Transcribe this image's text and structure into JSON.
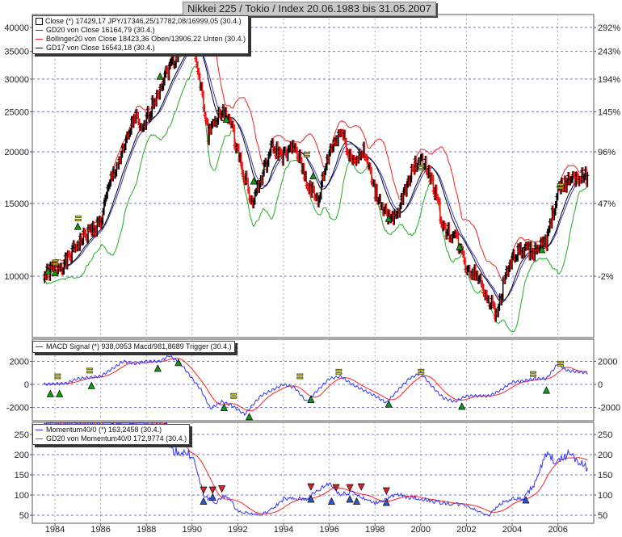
{
  "title": "Nikkei 225 / Tokio / Index 20.06.1983 bis 31.05.2007",
  "legend_main": [
    "Close (*) 17429,17 JPY/17346,25/17782,08/16999,05 (30.4.)",
    "GD20 von Close 16164,79 (30.4.)",
    "Bollinger20 von Close 18423,36 Oben/13906,22 Unten (30.4.)",
    "GD17 von Close 16543,18 (30.4.)"
  ],
  "legend_macd": [
    "MACD Signal (*) 938,0953 Macd/981,8689 Trigger (30.4.)"
  ],
  "legend_mom": [
    "Momentum40/0 (*) 163,2458 (30.4.)",
    "GD20 von Momentum40/0 172,9774 (30.4.)"
  ],
  "colors": {
    "close": "#000000",
    "gd20": "#3333cc",
    "bollinger": "#ee2222",
    "bollinger_lower": "#22aa22",
    "gd17": "#000000",
    "macd": "#3333ff",
    "trigger": "#ff2222",
    "grid": "#7777bb"
  },
  "chart_data": [
    {
      "type": "line",
      "panel": "price",
      "scale": "log",
      "ylim": [
        8000,
        40000
      ],
      "yticks_left": [
        "40000",
        "35000",
        "30000",
        "25000",
        "20000",
        "15000",
        "10000"
      ],
      "ytick_values": [
        40000,
        35000,
        30000,
        25000,
        20000,
        15000,
        10000
      ],
      "yticks_right": [
        "292%",
        "243%",
        "194%",
        "145%",
        "96%",
        "47%",
        "-2%"
      ],
      "xticks": [
        "1984",
        "1986",
        "1988",
        "1990",
        "1992",
        "1994",
        "1996",
        "1998",
        "2000",
        "2002",
        "2004",
        "2006"
      ],
      "close": [
        [
          1983.5,
          10000
        ],
        [
          1984,
          10500
        ],
        [
          1984.5,
          10800
        ],
        [
          1985,
          12000
        ],
        [
          1985.5,
          12800
        ],
        [
          1986,
          13500
        ],
        [
          1986.5,
          17500
        ],
        [
          1987,
          20000
        ],
        [
          1987.5,
          24500
        ],
        [
          1987.8,
          22000
        ],
        [
          1988,
          24000
        ],
        [
          1988.5,
          28000
        ],
        [
          1989,
          32000
        ],
        [
          1989.9,
          38900
        ],
        [
          1990.3,
          30000
        ],
        [
          1990.7,
          22000
        ],
        [
          1991,
          24000
        ],
        [
          1991.5,
          25000
        ],
        [
          1992,
          20000
        ],
        [
          1992.6,
          15000
        ],
        [
          1993,
          17000
        ],
        [
          1993.5,
          20500
        ],
        [
          1994,
          19500
        ],
        [
          1994.5,
          20500
        ],
        [
          1995,
          17000
        ],
        [
          1995.5,
          15000
        ],
        [
          1996,
          20000
        ],
        [
          1996.5,
          22500
        ],
        [
          1997,
          19000
        ],
        [
          1997.5,
          20000
        ],
        [
          1998,
          16000
        ],
        [
          1998.7,
          13500
        ],
        [
          1999,
          14000
        ],
        [
          1999.5,
          17500
        ],
        [
          2000,
          19500
        ],
        [
          2000.5,
          17000
        ],
        [
          2001,
          13000
        ],
        [
          2001.5,
          12500
        ],
        [
          2002,
          10500
        ],
        [
          2002.5,
          10000
        ],
        [
          2003.3,
          8000
        ],
        [
          2003.8,
          10500
        ],
        [
          2004.3,
          11500
        ],
        [
          2005,
          11500
        ],
        [
          2005.5,
          12000
        ],
        [
          2006,
          16000
        ],
        [
          2006.4,
          17000
        ],
        [
          2006.8,
          17500
        ],
        [
          2007.3,
          17400
        ]
      ],
      "signals_buy": [
        [
          1983.7,
          10300
        ],
        [
          1984.0,
          10200
        ],
        [
          1985.0,
          13200
        ],
        [
          1988.6,
          30500
        ],
        [
          1991.5,
          24000
        ],
        [
          1992.7,
          17000
        ],
        [
          1995.3,
          17500
        ],
        [
          1998.6,
          13800
        ],
        [
          2001.7,
          11800
        ],
        [
          2005.3,
          11600
        ]
      ],
      "signals_neutral": [
        [
          1984.0,
          10800
        ],
        [
          1985.0,
          13800
        ],
        [
          1995.0,
          19700
        ],
        [
          2000.0,
          18300
        ],
        [
          2006.1,
          16500
        ]
      ]
    },
    {
      "type": "line",
      "panel": "macd",
      "ylim": [
        -3000,
        3000
      ],
      "yticks": [
        "2000",
        "0",
        "-2000"
      ],
      "ytick_values": [
        2000,
        0,
        -2000
      ],
      "macd": [
        [
          1983.5,
          0
        ],
        [
          1984.5,
          100
        ],
        [
          1985,
          500
        ],
        [
          1986,
          700
        ],
        [
          1987,
          2000
        ],
        [
          1987.5,
          1800
        ],
        [
          1988,
          2000
        ],
        [
          1988.6,
          2000
        ],
        [
          1989,
          2500
        ],
        [
          1989.5,
          1800
        ],
        [
          1990.4,
          -500
        ],
        [
          1990.8,
          -2100
        ],
        [
          1991.3,
          -1500
        ],
        [
          1991.7,
          -1800
        ],
        [
          1992.3,
          -2600
        ],
        [
          1993,
          -1000
        ],
        [
          1993.5,
          -500
        ],
        [
          1994,
          0
        ],
        [
          1994.5,
          -300
        ],
        [
          1995,
          -1500
        ],
        [
          1995.5,
          -500
        ],
        [
          1996,
          500
        ],
        [
          1996.5,
          700
        ],
        [
          1997,
          0
        ],
        [
          1997.5,
          -500
        ],
        [
          1998,
          -1000
        ],
        [
          1998.5,
          -1600
        ],
        [
          1999,
          -500
        ],
        [
          1999.5,
          500
        ],
        [
          2000,
          1000
        ],
        [
          2000.5,
          -200
        ],
        [
          2001,
          -1200
        ],
        [
          2001.5,
          -1500
        ],
        [
          2002,
          -1000
        ],
        [
          2003,
          -1000
        ],
        [
          2003.5,
          -500
        ],
        [
          2004,
          200
        ],
        [
          2004.5,
          300
        ],
        [
          2005,
          500
        ],
        [
          2005.5,
          500
        ],
        [
          2006,
          1800
        ],
        [
          2006.4,
          1200
        ],
        [
          2007.3,
          1000
        ]
      ],
      "signals_buy": [
        [
          1983.8,
          -800
        ],
        [
          1984.2,
          -800
        ],
        [
          1985.6,
          -100
        ],
        [
          1988.5,
          1400
        ],
        [
          1989.4,
          1900
        ],
        [
          1991.4,
          -2000
        ],
        [
          1992.5,
          -2800
        ],
        [
          1995.2,
          -1300
        ],
        [
          1998.6,
          -1700
        ],
        [
          2001.8,
          -1900
        ],
        [
          2005.5,
          -500
        ]
      ],
      "signals_neutral": [
        [
          1984.1,
          700
        ],
        [
          1985.5,
          1200
        ],
        [
          1991.8,
          -1000
        ],
        [
          1994.7,
          700
        ],
        [
          1996.4,
          1100
        ],
        [
          2000.0,
          1100
        ],
        [
          2004.9,
          900
        ],
        [
          2006.1,
          1800
        ]
      ]
    },
    {
      "type": "line",
      "panel": "momentum",
      "ylim": [
        30,
        270
      ],
      "yticks": [
        "250",
        "200",
        "150",
        "100",
        "50"
      ],
      "ytick_values": [
        250,
        200,
        150,
        100,
        50
      ],
      "momentum": [
        [
          1983.5,
          280
        ],
        [
          1988.9,
          280
        ],
        [
          1989,
          215
        ],
        [
          1989.5,
          205
        ],
        [
          1990,
          200
        ],
        [
          1990.5,
          100
        ],
        [
          1991,
          80
        ],
        [
          1991.5,
          100
        ],
        [
          1992,
          60
        ],
        [
          1993,
          50
        ],
        [
          1993.5,
          65
        ],
        [
          1994,
          90
        ],
        [
          1995,
          90
        ],
        [
          1995.5,
          110
        ],
        [
          1996,
          130
        ],
        [
          1996.5,
          100
        ],
        [
          1997,
          110
        ],
        [
          1997.5,
          90
        ],
        [
          1998,
          80
        ],
        [
          1999,
          100
        ],
        [
          2000,
          90
        ],
        [
          2001,
          80
        ],
        [
          2002,
          75
        ],
        [
          2002.5,
          60
        ],
        [
          2003,
          50
        ],
        [
          2003.5,
          80
        ],
        [
          2004,
          90
        ],
        [
          2004.5,
          90
        ],
        [
          2005,
          130
        ],
        [
          2005.5,
          200
        ],
        [
          2006,
          180
        ],
        [
          2006.5,
          205
        ],
        [
          2007.3,
          165
        ]
      ],
      "signals_sell": [
        [
          1990.5,
          112
        ],
        [
          1990.9,
          112
        ],
        [
          1991.3,
          115
        ],
        [
          1995.2,
          120
        ],
        [
          1996.3,
          118
        ],
        [
          1996.9,
          118
        ],
        [
          1997.4,
          120
        ],
        [
          1998.5,
          110
        ]
      ],
      "signals_buy": [
        [
          1990.5,
          85
        ],
        [
          1990.9,
          95
        ],
        [
          1995.2,
          90
        ],
        [
          1996.1,
          85
        ],
        [
          1996.9,
          90
        ],
        [
          1997.2,
          85
        ],
        [
          1998.5,
          82
        ],
        [
          2004.6,
          88
        ]
      ]
    }
  ]
}
